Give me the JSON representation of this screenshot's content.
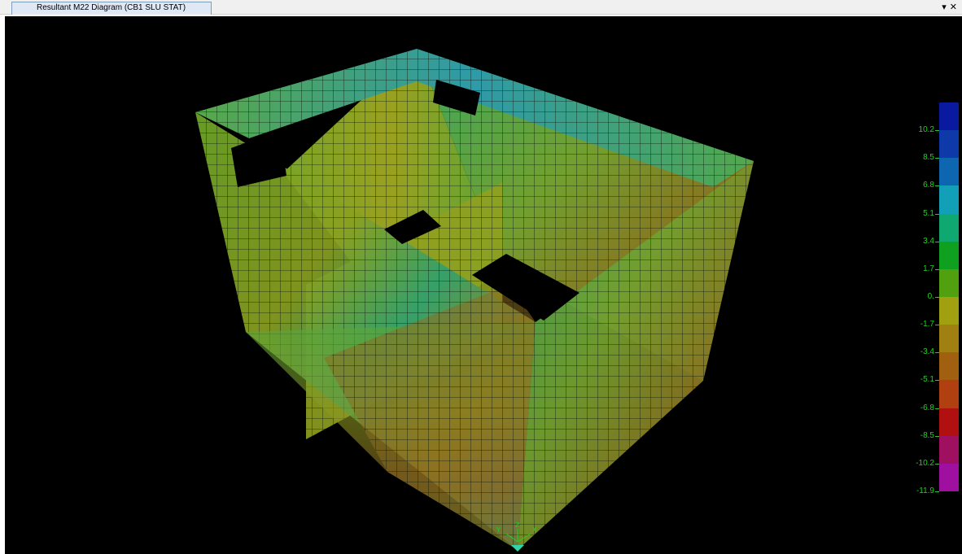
{
  "window": {
    "tab_title": "Resultant M22 Diagram   (CB1 SLU STAT)",
    "dropdown_glyph": "▾",
    "close_glyph": "✕"
  },
  "legend": {
    "labels": [
      "10.2",
      "8.5",
      "6.8",
      "5.1",
      "3.4",
      "1.7",
      "0.",
      "-1.7",
      "-3.4",
      "-5.1",
      "-6.8",
      "-8.5",
      "-10.2",
      "-11.9"
    ],
    "colors": [
      "#0a1aa0",
      "#0d3aa8",
      "#0f66b0",
      "#11a0b8",
      "#0fa870",
      "#10a020",
      "#50a010",
      "#a0a010",
      "#a08010",
      "#a06010",
      "#b04010",
      "#b01010",
      "#a01060",
      "#a010a0"
    ]
  },
  "axes": {
    "labels": [
      "Y",
      "Z",
      "X"
    ]
  },
  "colors": {
    "background": "#000000",
    "mesh_line": "#0a1a0a",
    "legend_text": "#1fd41f"
  }
}
